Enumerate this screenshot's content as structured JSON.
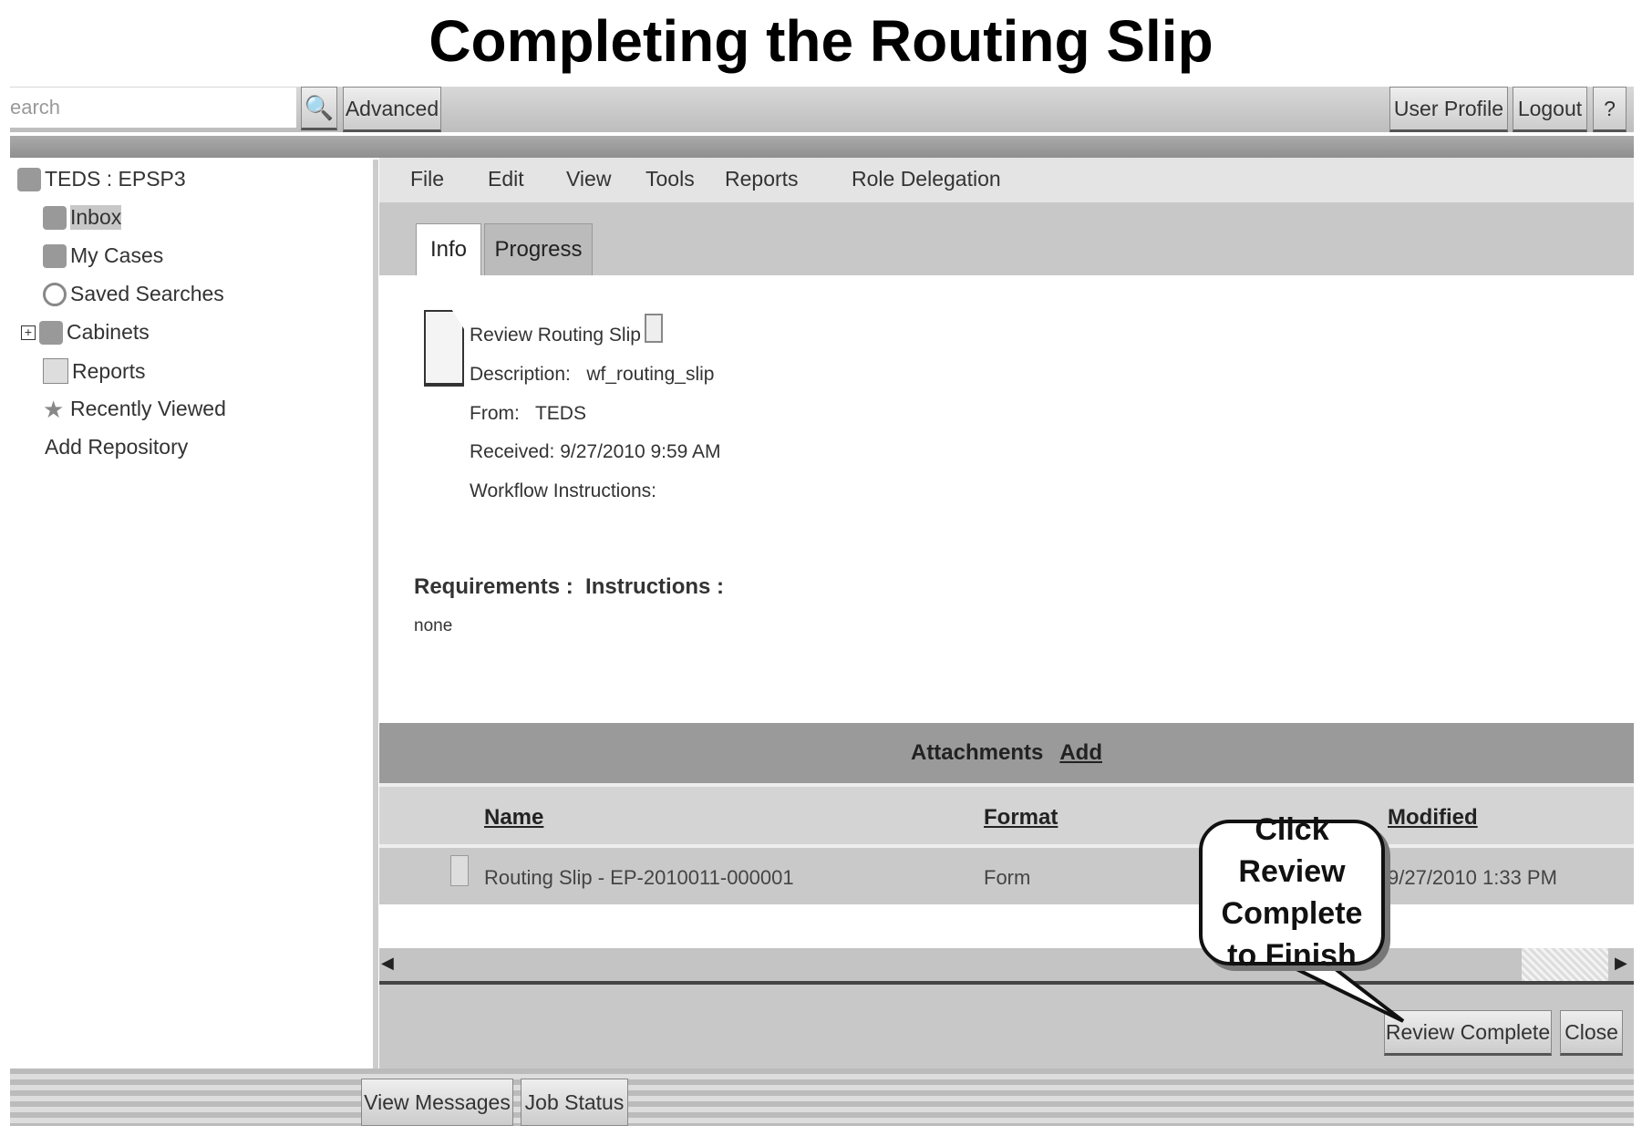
{
  "title": "Completing the Routing Slip",
  "topbar": {
    "search_value": "earch",
    "advanced": "Advanced",
    "user_profile": "User Profile",
    "logout": "Logout",
    "help": "?"
  },
  "sidebar": {
    "root": "TEDS : EPSP3",
    "items": [
      {
        "label": "Inbox",
        "icon": "inbox-icon"
      },
      {
        "label": "My Cases",
        "icon": "cases-icon"
      },
      {
        "label": "Saved Searches",
        "icon": "search-icon"
      },
      {
        "label": "Cabinets",
        "icon": "cabinet-icon"
      },
      {
        "label": "Reports",
        "icon": "report-icon"
      },
      {
        "label": "Recently Viewed",
        "icon": "star-icon"
      }
    ],
    "add_repository": "Add Repository"
  },
  "menu": [
    "File",
    "Edit",
    "View",
    "Tools",
    "Reports",
    "Role Delegation"
  ],
  "tabs": [
    "Info",
    "Progress"
  ],
  "info": {
    "name": "Review Routing Slip",
    "description": "Description:   wf_routing_slip",
    "from": "From:   TEDS",
    "received": "Received: 9/27/2010 9:59 AM",
    "workflow": "Workflow Instructions:",
    "requirements": "Requirements :  Instructions :",
    "none": "none"
  },
  "attachments": {
    "label": "Attachments",
    "add": "Add",
    "columns": [
      "Name",
      "Format",
      "Modified"
    ],
    "rows": [
      {
        "name": "Routing Slip - EP-2010011-000001",
        "format": "Form",
        "modified": "9/27/2010 1:33 PM"
      }
    ]
  },
  "buttons": {
    "review_complete": "Review Complete",
    "close": "Close"
  },
  "bottom": {
    "view_messages": "View Messages",
    "job_status": "Job Status"
  },
  "callout": "Click Review Complete to Finish"
}
